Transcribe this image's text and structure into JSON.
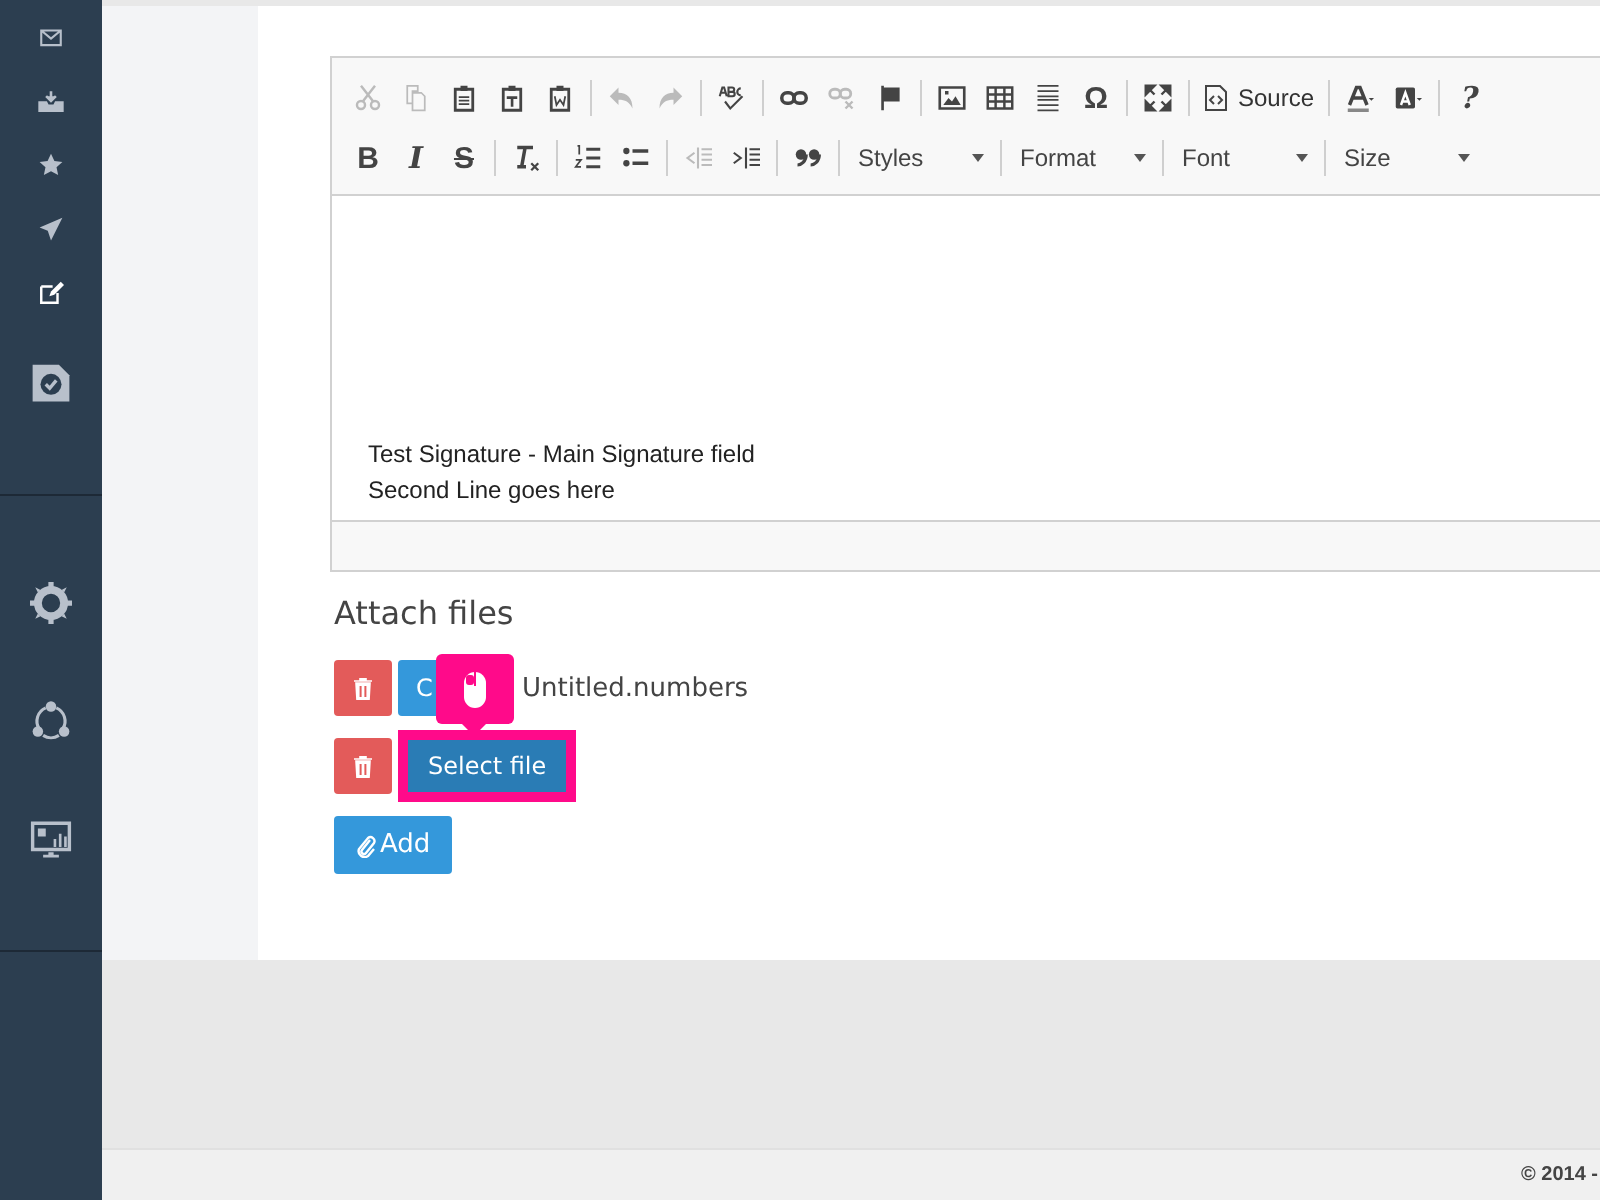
{
  "sidebar": {
    "items": [
      {
        "kind": "small",
        "selected": false
      },
      {
        "kind": "small",
        "selected": false
      },
      {
        "kind": "small",
        "selected": false
      },
      {
        "kind": "small",
        "selected": false
      },
      {
        "kind": "small",
        "selected": true
      },
      {
        "kind": "large",
        "selected": false
      },
      {
        "kind": "divider"
      },
      {
        "kind": "large",
        "selected": false
      },
      {
        "kind": "large",
        "selected": false
      },
      {
        "kind": "large",
        "selected": false
      },
      {
        "kind": "divider"
      }
    ]
  },
  "editor": {
    "toolbar": [
      [
        {
          "kind": "icon",
          "disabled": true
        },
        {
          "kind": "icon",
          "disabled": true
        },
        {
          "kind": "icon",
          "disabled": false
        },
        {
          "kind": "icon",
          "disabled": false
        },
        {
          "kind": "icon",
          "disabled": false
        },
        {
          "kind": "sep"
        },
        {
          "kind": "icon",
          "disabled": true
        },
        {
          "kind": "icon",
          "disabled": true
        },
        {
          "kind": "sep"
        },
        {
          "kind": "icon",
          "disabled": false
        },
        {
          "kind": "sep"
        },
        {
          "kind": "icon",
          "disabled": false
        },
        {
          "kind": "icon",
          "disabled": true
        },
        {
          "kind": "icon",
          "disabled": false
        },
        {
          "kind": "sep"
        },
        {
          "kind": "icon",
          "disabled": false
        },
        {
          "kind": "icon",
          "disabled": false
        },
        {
          "kind": "icon",
          "disabled": false
        },
        {
          "kind": "glyph",
          "label": "Ω"
        },
        {
          "kind": "sep"
        },
        {
          "kind": "icon",
          "disabled": false
        },
        {
          "kind": "sep"
        },
        {
          "kind": "labeled",
          "label": "Source"
        },
        {
          "kind": "sep"
        },
        {
          "kind": "icon",
          "disabled": false
        },
        {
          "kind": "icon",
          "disabled": false
        },
        {
          "kind": "sep"
        },
        {
          "kind": "glyph",
          "label": "?"
        }
      ],
      [
        {
          "kind": "glyph",
          "label": "B"
        },
        {
          "kind": "glyph",
          "label": "I"
        },
        {
          "kind": "glyph",
          "label": "S"
        },
        {
          "kind": "sep"
        },
        {
          "kind": "icon",
          "disabled": false
        },
        {
          "kind": "sep"
        },
        {
          "kind": "icon",
          "disabled": false
        },
        {
          "kind": "icon",
          "disabled": false
        },
        {
          "kind": "sep"
        },
        {
          "kind": "icon",
          "disabled": true
        },
        {
          "kind": "icon",
          "disabled": false
        },
        {
          "kind": "sep"
        },
        {
          "kind": "icon",
          "disabled": false
        },
        {
          "kind": "sep"
        },
        {
          "kind": "combo",
          "label": "Styles"
        },
        {
          "kind": "sep"
        },
        {
          "kind": "combo",
          "label": "Format"
        },
        {
          "kind": "sep"
        },
        {
          "kind": "combo",
          "label": "Font"
        },
        {
          "kind": "sep"
        },
        {
          "kind": "combo",
          "label": "Size"
        }
      ]
    ],
    "content": [
      "Test Signature - Main Signature field",
      "Second Line goes here"
    ]
  },
  "attach": {
    "title": "Attach files",
    "rows": [
      {
        "button": "C",
        "filename": "Untitled.numbers",
        "highlighted": false
      },
      {
        "button": "Select file",
        "filename": "",
        "highlighted": true
      }
    ],
    "add_button": "Add"
  },
  "footer": {
    "text": "© 2014 -"
  }
}
